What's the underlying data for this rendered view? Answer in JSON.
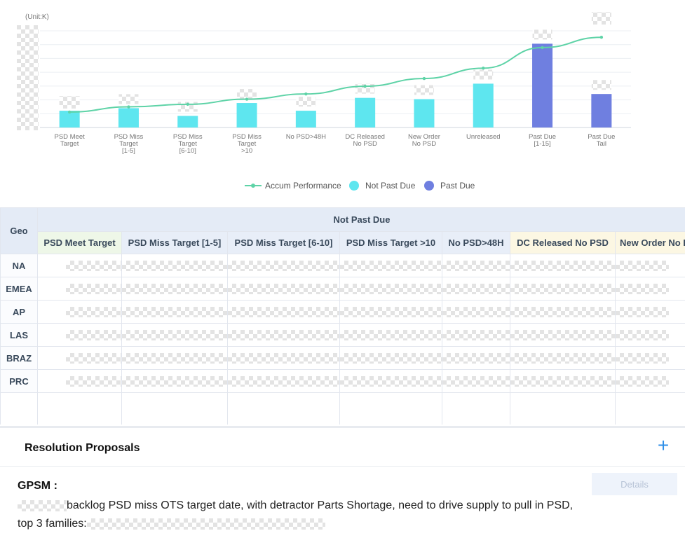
{
  "chart_data": {
    "type": "bar",
    "unit_label": "(Unit:K)",
    "categories": [
      "PSD Meet Target",
      "PSD Miss Target [1-5]",
      "PSD Miss Target [6-10]",
      "PSD Miss Target >10",
      "No PSD>48H",
      "DC Released No PSD",
      "New Order No PSD",
      "Unreleased",
      "Past Due [1-15]",
      "Past Due Tail"
    ],
    "category_lines": [
      [
        "PSD Meet",
        "Target"
      ],
      [
        "PSD Miss",
        "Target",
        "[1-5]"
      ],
      [
        "PSD Miss",
        "Target",
        "[6-10]"
      ],
      [
        "PSD Miss",
        "Target",
        ">10"
      ],
      [
        "No PSD>48H"
      ],
      [
        "DC Released",
        "No PSD"
      ],
      [
        "New Order",
        "No PSD"
      ],
      [
        "Unreleased"
      ],
      [
        "Past Due",
        "[1-15]"
      ],
      [
        "Past Due",
        "Tail"
      ]
    ],
    "series": [
      {
        "name": "Not Past Due",
        "kind": "bar",
        "color": "#5ee6ef",
        "values": [
          13,
          15,
          9,
          19,
          13,
          23,
          22,
          34,
          null,
          null
        ]
      },
      {
        "name": "Past Due",
        "kind": "bar",
        "color": "#6f7fe0",
        "values": [
          null,
          null,
          null,
          null,
          null,
          null,
          null,
          null,
          65,
          26
        ]
      },
      {
        "name": "Accum Performance",
        "kind": "line",
        "color": "#5ed3a7",
        "values": [
          12,
          16,
          18,
          22,
          26,
          32,
          38,
          46,
          62,
          70
        ]
      }
    ],
    "ylim": [
      0,
      75
    ],
    "grid": true,
    "legend_position": "bottom-center"
  },
  "table": {
    "geo_header": "Geo",
    "group_header": "Not Past Due",
    "columns": [
      "PSD Meet Target",
      "PSD Miss Target [1-5]",
      "PSD Miss Target [6-10]",
      "PSD Miss Target >10",
      "No PSD>48H",
      "DC Released No PSD",
      "New Order No PSD"
    ],
    "rows": [
      "NA",
      "EMEA",
      "AP",
      "LAS",
      "BRAZ",
      "PRC"
    ]
  },
  "proposals": {
    "title": "Resolution Proposals",
    "add_symbol": "+",
    "gpsm_label": "GPSM :",
    "details_label": "Details",
    "line1": "backlog PSD miss OTS target date, with detractor Parts Shortage, need to drive supply to pull in PSD,",
    "line2": "top 3 families:"
  },
  "colors": {
    "accent": "#2f8fe8",
    "not_past_due": "#5ee6ef",
    "past_due": "#6f7fe0",
    "accum": "#5ed3a7"
  }
}
